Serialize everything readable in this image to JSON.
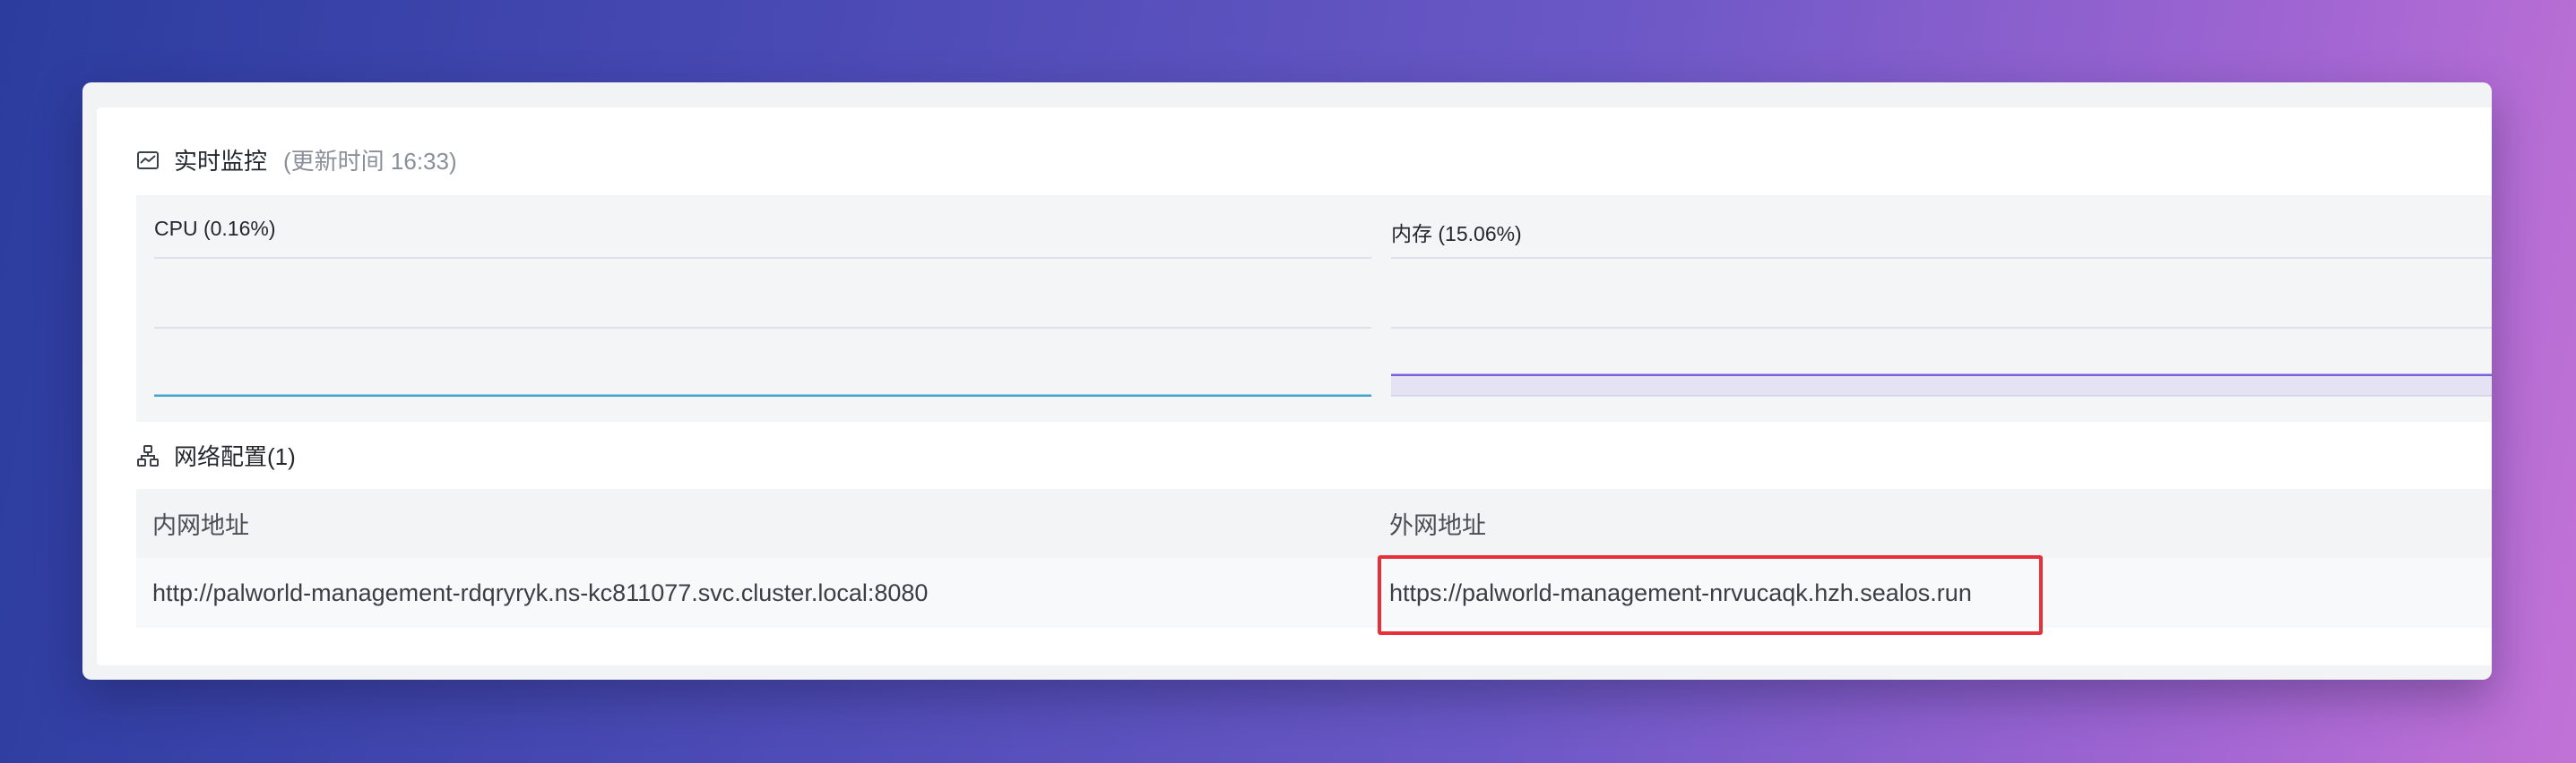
{
  "monitor": {
    "title": "实时监控",
    "update_time": "(更新时间  16:33)",
    "cpu_label": "CPU  (0.16%)",
    "memory_label": "内存  (15.06%)",
    "cpu_color": "#41a4c8",
    "memory_color": "#7b61d9"
  },
  "network": {
    "title": "网络配置(1)",
    "columns": [
      "内网地址",
      "外网地址"
    ],
    "rows": [
      {
        "internal": "http://palworld-management-rdqryryk.ns-kc811077.svc.cluster.local:8080",
        "external": "https://palworld-management-nrvucaqk.hzh.sealos.run"
      }
    ]
  },
  "icons": {
    "monitor": "line-chart-icon",
    "network": "network-icon"
  },
  "chart_data": [
    {
      "type": "area",
      "title": "CPU  (0.16%)",
      "series": [
        {
          "name": "CPU",
          "values": [
            0.16,
            0.16,
            0.16,
            0.16,
            0.16
          ]
        }
      ],
      "ylim": [
        0,
        100
      ],
      "grid": true
    },
    {
      "type": "area",
      "title": "内存  (15.06%)",
      "series": [
        {
          "name": "内存",
          "values": [
            15.06,
            15.06,
            15.06,
            15.06,
            15.06
          ]
        }
      ],
      "ylim": [
        0,
        100
      ],
      "grid": true
    }
  ]
}
